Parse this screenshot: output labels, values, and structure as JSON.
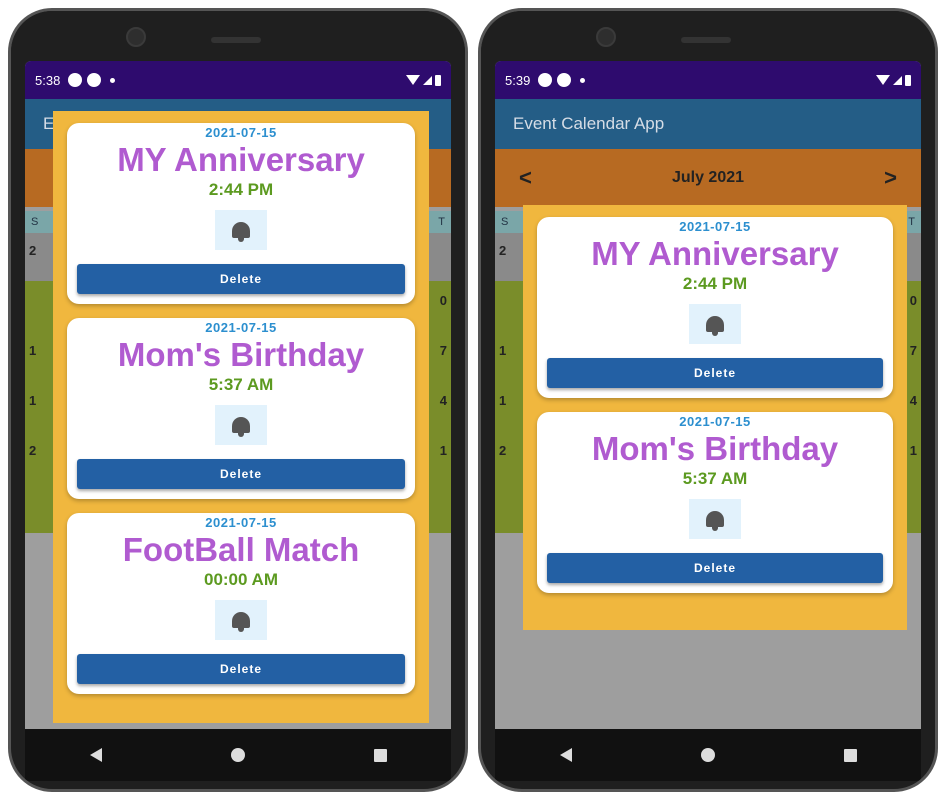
{
  "left_phone": {
    "status": {
      "time": "5:38"
    },
    "appbar": {
      "title": "E"
    },
    "weekdays": {
      "first": "S",
      "last": "T"
    },
    "side_numbers_left": [
      "2",
      "1",
      "1",
      "2"
    ],
    "side_numbers_right": [
      "0",
      "7",
      "4",
      "1"
    ],
    "events": [
      {
        "date": "2021-07-15",
        "title": "MY Anniversary",
        "time": "2:44 PM",
        "delete_label": "Delete",
        "icon": "alarm-bell-icon"
      },
      {
        "date": "2021-07-15",
        "title": "Mom's Birthday",
        "time": "5:37 AM",
        "delete_label": "Delete",
        "icon": "alarm-bell-icon"
      },
      {
        "date": "2021-07-15",
        "title": "FootBall Match",
        "time": "00:00 AM",
        "delete_label": "Delete",
        "icon": "alarm-bell-icon"
      }
    ]
  },
  "right_phone": {
    "status": {
      "time": "5:39"
    },
    "appbar": {
      "title": "Event Calendar App"
    },
    "month_nav": {
      "prev": "<",
      "month": "July 2021",
      "next": ">"
    },
    "weekdays": {
      "first": "S",
      "last": "T"
    },
    "side_numbers_left": [
      "2",
      "1",
      "1",
      "2"
    ],
    "side_numbers_right": [
      "0",
      "7",
      "4",
      "1"
    ],
    "events": [
      {
        "date": "2021-07-15",
        "title": "MY Anniversary",
        "time": "2:44 PM",
        "delete_label": "Delete",
        "icon": "alarm-bell-icon"
      },
      {
        "date": "2021-07-15",
        "title": "Mom's Birthday",
        "time": "5:37 AM",
        "delete_label": "Delete",
        "icon": "alarm-bell-icon"
      }
    ]
  },
  "colors": {
    "status_bar": "#2e0b6e",
    "app_bar": "#245d86",
    "month_bar": "#b76a22",
    "dialog_bg": "#f0b73e",
    "event_title": "#b05bd0",
    "event_date": "#2c8fcf",
    "event_time": "#5c9a20",
    "delete_button": "#2360a4"
  }
}
